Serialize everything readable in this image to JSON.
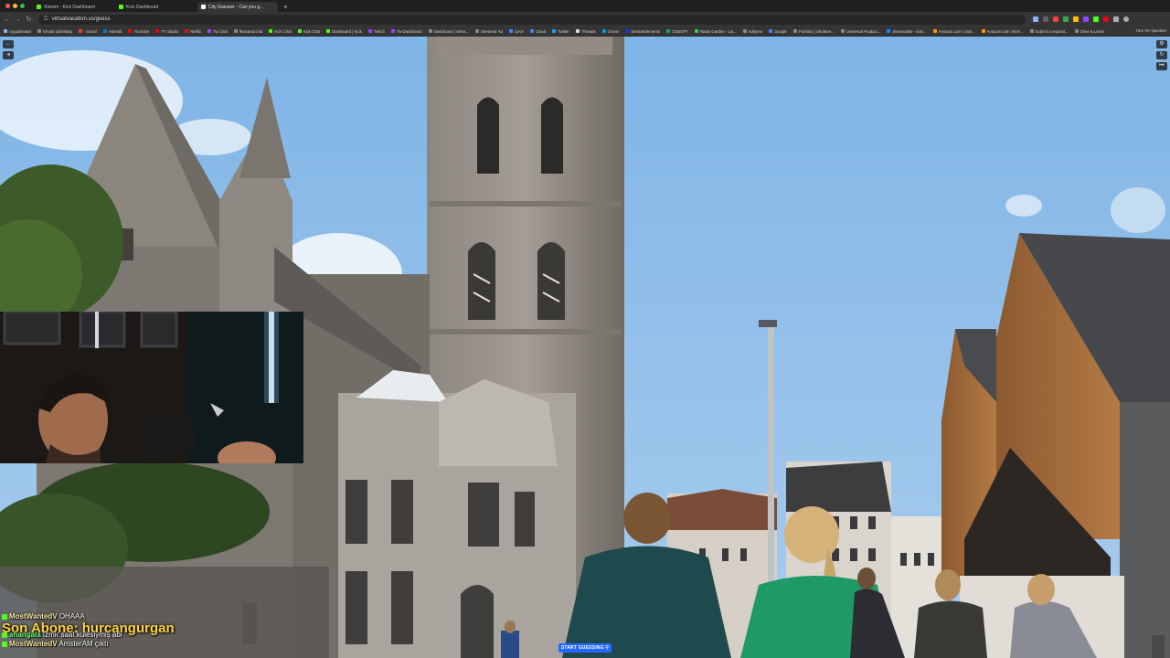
{
  "browser": {
    "tabs": [
      {
        "label": "Stream - Kick Dashboard",
        "color": "#53fc18"
      },
      {
        "label": "Kick Dashboard",
        "color": "#53fc18"
      },
      {
        "label": "City Guesser - Can you g...",
        "color": "#ffffff"
      }
    ],
    "url": "virtualvacation.us/guess",
    "bookmarks": [
      {
        "label": "Uygulamalar",
        "color": "#8ab4f8"
      },
      {
        "label": "Emrah Şahinbaş",
        "color": "#888888"
      },
      {
        "label": "- Gmail",
        "color": "#ea4335"
      },
      {
        "label": "Hotmail",
        "color": "#0078d4"
      },
      {
        "label": "YouTube",
        "color": "#ff0000"
      },
      {
        "label": "YT Studio",
        "color": "#ff0000"
      },
      {
        "label": "Netflix",
        "color": "#e50914"
      },
      {
        "label": "Tw Chat",
        "color": "#9146ff"
      },
      {
        "label": "fleasand.chat",
        "color": "#888888"
      },
      {
        "label": "Kick Chat",
        "color": "#53fc18"
      },
      {
        "label": "Kick Chat",
        "color": "#53fc18"
      },
      {
        "label": "Dashboard | Kick",
        "color": "#53fc18"
      },
      {
        "label": "Twitch",
        "color": "#9146ff"
      },
      {
        "label": "Tw Dashboard",
        "color": "#9146ff"
      },
      {
        "label": "Dashboard | Strea...",
        "color": "#888888"
      },
      {
        "label": "Streamer Ad",
        "color": "#888888"
      },
      {
        "label": "Çevir",
        "color": "#4285f4"
      },
      {
        "label": "Cloud",
        "color": "#4285f4"
      },
      {
        "label": "Twitter",
        "color": "#1da1f2"
      },
      {
        "label": "Threads",
        "color": "#dddddd"
      },
      {
        "label": "Ocean",
        "color": "#00a1e0"
      },
      {
        "label": "StreamElements",
        "color": "#2a2aff"
      },
      {
        "label": "ChatGPT",
        "color": "#10a37f"
      },
      {
        "label": "Radio Garden - Lis...",
        "color": "#3ec46d"
      },
      {
        "label": "Adliyme",
        "color": "#888888"
      },
      {
        "label": "Google",
        "color": "#4285f4"
      },
      {
        "label": "Portfolio | Shuttere...",
        "color": "#888888"
      },
      {
        "label": "Universal Product...",
        "color": "#888888"
      },
      {
        "label": "Streamable - vide...",
        "color": "#0f90fa"
      },
      {
        "label": "Amazon.com: USB...",
        "color": "#ff9900"
      },
      {
        "label": "Amazon.com: NOV...",
        "color": "#ff9900"
      },
      {
        "label": "Submit a request...",
        "color": "#888888"
      },
      {
        "label": "Drive & Listen",
        "color": "#888888"
      }
    ],
    "bookmarks_right": "Tüm Yer İşaretleri"
  },
  "game": {
    "start_button": "START GUESSING ⚲"
  },
  "chat": {
    "line1_user": "MostWantedV",
    "line1_text": "OHAAA",
    "sub_banner": "Son Abone: hurcangurgan",
    "line2_user": "ahangala",
    "line2_text": "İzmir saat kulesiymiş abi",
    "line3_user": "MostWantedV",
    "line3_text": "AmsterAM çıktı"
  }
}
